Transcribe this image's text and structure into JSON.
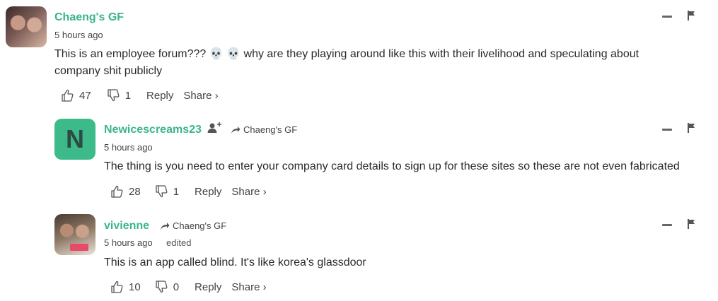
{
  "comments": [
    {
      "username": "Chaeng's GF",
      "timestamp": "5 hours ago",
      "text_line1": "This is an employee forum??? 💀 💀  why are they playing around like this with their livelihood and speculating about",
      "text_line2": "company shit publicly",
      "likes": "47",
      "dislikes": "1",
      "reply_label": "Reply",
      "share_label": "Share ›"
    },
    {
      "username": "Newicescreams23",
      "avatar_letter": "N",
      "reply_to": "Chaeng's GF",
      "timestamp": "5 hours ago",
      "text_line1": "The thing is you need to enter your company card details to sign up for these sites so these are not even fabricated",
      "likes": "28",
      "dislikes": "1",
      "reply_label": "Reply",
      "share_label": "Share ›"
    },
    {
      "username": "vivienne",
      "reply_to": "Chaeng's GF",
      "timestamp": "5 hours ago",
      "edited": "edited",
      "text_line1": "This is an app called blind. It's like korea's glassdoor",
      "likes": "10",
      "dislikes": "0",
      "reply_label": "Reply",
      "share_label": "Share ›"
    }
  ],
  "colors": {
    "username": "#3bb58a",
    "avatar_bg": "#3dba8a"
  },
  "icons": [
    "thumbs-up-icon",
    "thumbs-down-icon",
    "minus-icon",
    "flag-icon",
    "reply-arrow-icon",
    "follow-user-icon"
  ]
}
